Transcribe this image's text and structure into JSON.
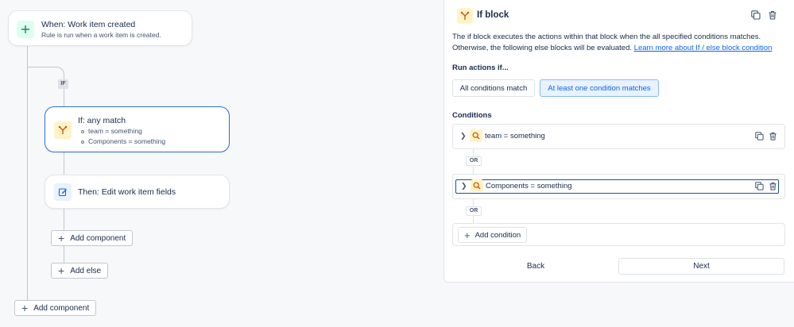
{
  "canvas": {
    "trigger": {
      "title": "When: Work item created",
      "subtitle": "Rule is run when a work item is created."
    },
    "if_tag": "IF",
    "if_card": {
      "title": "If: any match",
      "conditions": [
        "team = something",
        "Components = something"
      ]
    },
    "then_card": {
      "title": "Then: Edit work item fields"
    },
    "add_component_inner": "Add component",
    "add_else": "Add else",
    "add_component_outer": "Add component"
  },
  "panel": {
    "title": "If block",
    "description": "The if block executes the actions within that block when the all specified conditions matches. Otherwise, the following else blocks will be evaluated.",
    "learn_more": "Learn more about If / else block condition",
    "run_label": "Run actions if...",
    "options": {
      "all": "All conditions match",
      "any": "At least one condition matches"
    },
    "conditions_label": "Conditions",
    "conditions": [
      {
        "text": "team = something"
      },
      {
        "text": "Components = something"
      }
    ],
    "or_label": "OR",
    "add_condition": "Add condition",
    "back": "Back",
    "next": "Next"
  },
  "colors": {
    "accent": "#0c66e4",
    "selected_border": "#2c6fd9",
    "selected_option_bg": "#e9f2ff",
    "condition_icon_bg": "#fff3c7",
    "trigger_icon_bg": "#dcfff1"
  }
}
